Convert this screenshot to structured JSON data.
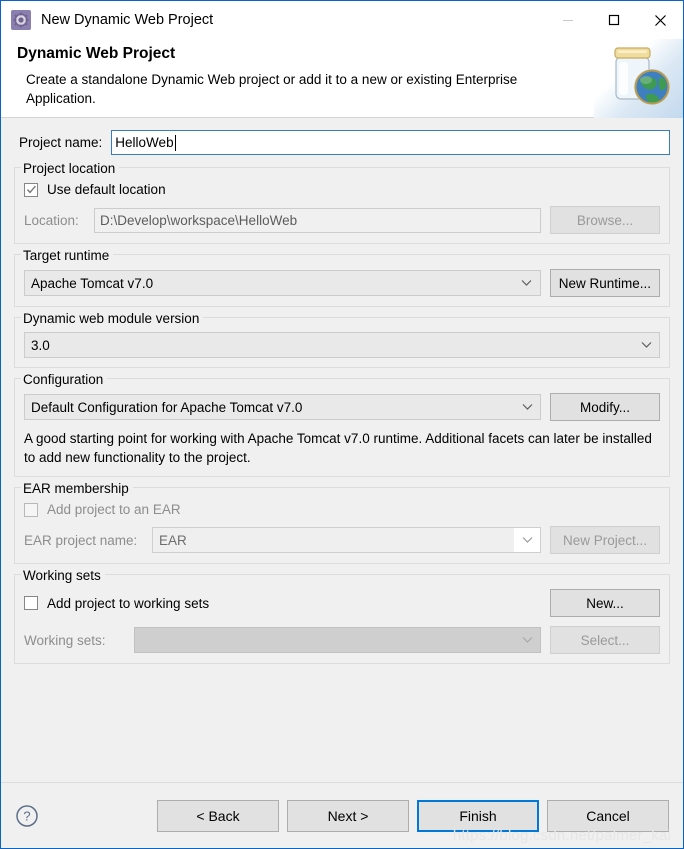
{
  "window": {
    "title": "New Dynamic Web Project",
    "icon": "gear-icon",
    "minimize_label": "—",
    "maximize_label": "□",
    "close_label": "✕"
  },
  "header": {
    "title": "Dynamic Web Project",
    "description": "Create a standalone Dynamic Web project or add it to a new or existing Enterprise Application.",
    "art": "jar-with-globe-icon"
  },
  "project_name": {
    "label": "Project name:",
    "value": "HelloWeb"
  },
  "project_location": {
    "legend": "Project location",
    "use_default_label": "Use default location",
    "use_default_checked": true,
    "location_label": "Location:",
    "location_value": "D:\\Develop\\workspace\\HelloWeb",
    "browse_label": "Browse...",
    "browse_enabled": false
  },
  "target_runtime": {
    "legend": "Target runtime",
    "value": "Apache Tomcat v7.0",
    "new_runtime_label": "New Runtime...",
    "new_runtime_enabled": true
  },
  "module_version": {
    "legend": "Dynamic web module version",
    "value": "3.0"
  },
  "configuration": {
    "legend": "Configuration",
    "value": "Default Configuration for Apache Tomcat v7.0",
    "modify_label": "Modify...",
    "modify_enabled": true,
    "description": "A good starting point for working with Apache Tomcat v7.0 runtime. Additional facets can later be installed to add new functionality to the project."
  },
  "ear_membership": {
    "legend": "EAR membership",
    "add_to_ear_label": "Add project to an EAR",
    "add_to_ear_checked": false,
    "add_to_ear_enabled": false,
    "ear_project_label": "EAR project name:",
    "ear_project_value": "EAR",
    "new_project_label": "New Project...",
    "new_project_enabled": false
  },
  "working_sets": {
    "legend": "Working sets",
    "add_to_working_sets_label": "Add project to working sets",
    "add_to_working_sets_checked": false,
    "new_label": "New...",
    "new_enabled": true,
    "working_sets_label": "Working sets:",
    "working_sets_value": "",
    "select_label": "Select...",
    "select_enabled": false
  },
  "footer": {
    "help_icon": "question-mark-icon",
    "back_label": "< Back",
    "next_label": "Next >",
    "finish_label": "Finish",
    "cancel_label": "Cancel",
    "focused_button": "Finish"
  },
  "watermark": {
    "text": "https://blog.csdn.net/palmer_kai"
  },
  "colors": {
    "dialog_border": "#0a64c8",
    "focus_blue": "#0078d7",
    "input_border_blue": "#3a7cb8",
    "background": "#f0f0f0",
    "disabled_text": "#8d8d8d"
  }
}
